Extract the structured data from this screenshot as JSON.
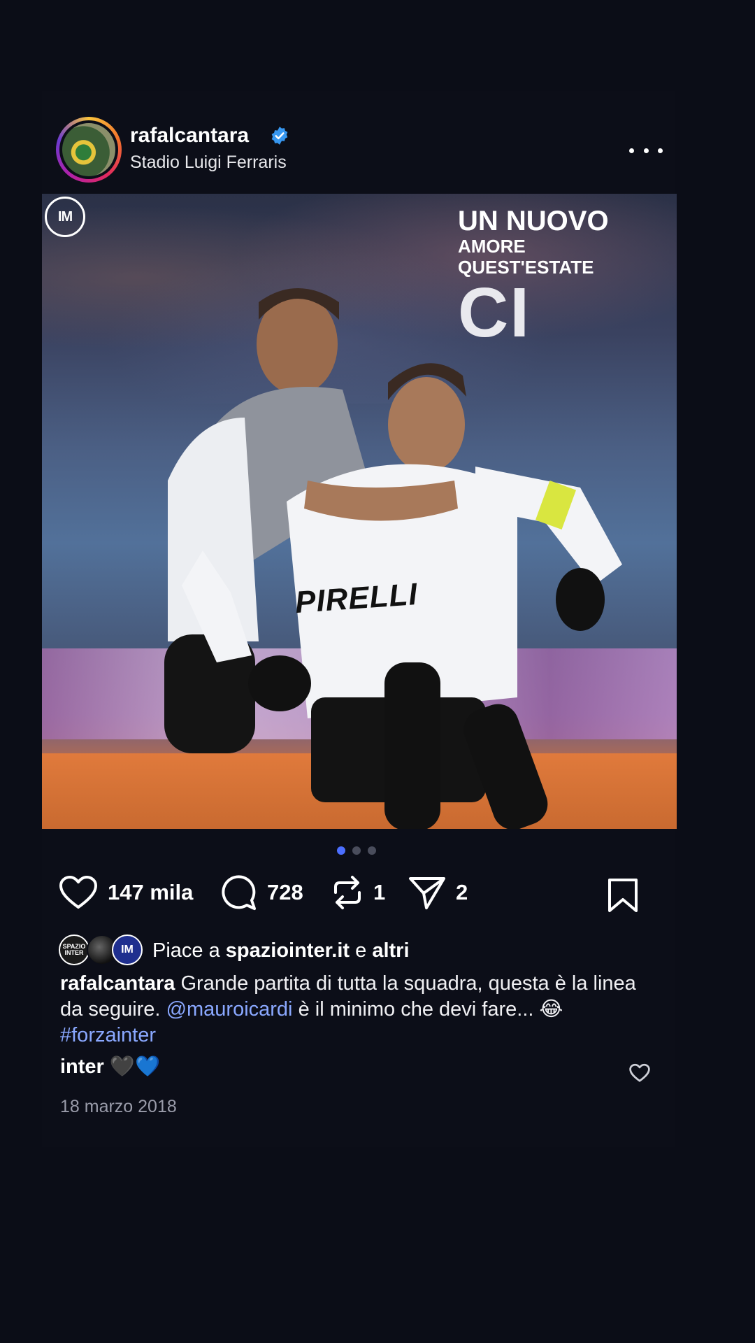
{
  "post": {
    "username": "rafalcantara",
    "location": "Stadio Luigi Ferraris",
    "photo": {
      "overlay_line1": "UN NUOVO",
      "overlay_line2": "AMORE",
      "overlay_line3": "QUEST'ESTATE",
      "overlay_line4": "CI",
      "club_logo_text": "IM",
      "sponsor_text": "PIRELLI"
    },
    "carousel": {
      "count": 3,
      "active_index": 0
    },
    "actions": {
      "likes": "147 mila",
      "comments": "728",
      "reposts": "1",
      "shares": "2"
    },
    "liked_by": {
      "prefix": "Piace a",
      "user": "spaziointer.it",
      "connector": "e",
      "others": "altri",
      "avatar1_text": "SPAZIO INTER",
      "avatar3_text": "IM"
    },
    "caption": {
      "user": "rafalcantara",
      "text1": "Grande partita di tutta la squadra, questa è la linea da seguire.",
      "mention": "@mauroicardi",
      "text2": "è il minimo che devi fare... 😂",
      "hashtag": "#forzainter"
    },
    "comment": {
      "user": "inter",
      "text": "🖤💙"
    },
    "date": "18 marzo 2018"
  },
  "colors": {
    "background": "#0b0d17",
    "link": "#8aa8ff",
    "verified": "#3797f0",
    "active_dot": "#4c6fff"
  }
}
